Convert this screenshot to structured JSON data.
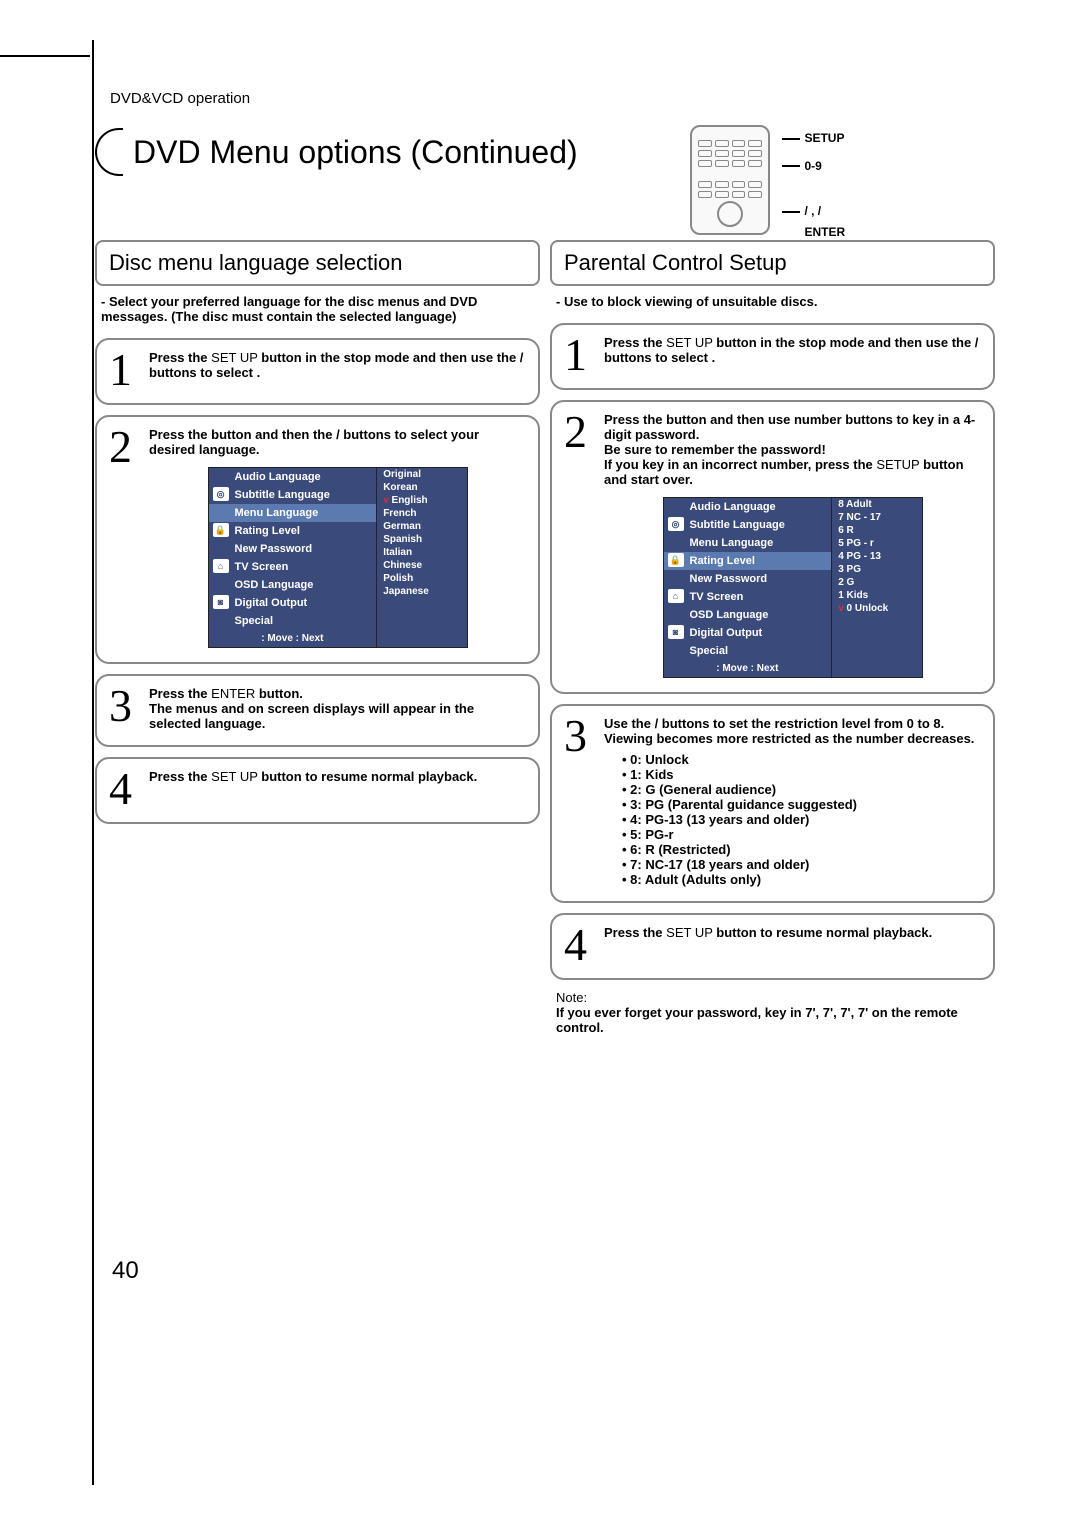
{
  "breadcrumb": "DVD&VCD operation",
  "title": "DVD Menu options (Continued)",
  "remote": {
    "l1": "SETUP",
    "l2": "0-9",
    "l3": "/ ,   /",
    "l4": "ENTER"
  },
  "left": {
    "heading": "Disc menu language selection",
    "intro": "- Select your preferred language for the disc menus and DVD messages. (The disc must contain the selected language)",
    "s1a": "Press the",
    "s1b": " SET UP ",
    "s1c": "button in the stop mode and then use the   /   buttons to select .",
    "s2a": "Press the   button and then the   /   buttons to select your desired language.",
    "s3a": "Press the",
    "s3b": " ENTER ",
    "s3c": "button.",
    "s3d": "The menus and on screen displays will appear in the selected language.",
    "s4a": "Press the",
    "s4b": " SET UP ",
    "s4c": "button to resume normal playback.",
    "osd_left": [
      "Audio Language",
      "Subtitle Language",
      "Menu Language",
      "Rating Level",
      "New Password",
      "TV Screen",
      "OSD Language",
      "Digital Output",
      "Special"
    ],
    "osd_foot": ": Move        : Next",
    "osd_right": [
      "Original",
      "Korean",
      "English",
      "French",
      "German",
      "Spanish",
      "Italian",
      "Chinese",
      "Polish",
      "Japanese"
    ]
  },
  "right": {
    "heading": "Parental Control Setup",
    "intro": "- Use to block viewing of unsuitable discs.",
    "s1a": "Press the",
    "s1b": " SET UP ",
    "s1c": "button in the stop mode and then use the   /   buttons to select .",
    "s2a": "Press the   button and then use number buttons to key in a 4-digit password.",
    "s2b": "Be sure to remember the password!",
    "s2c": "If you key in an incorrect number, press the",
    "s2d": " SETUP ",
    "s2e": "button and start over.",
    "osd_left": [
      "Audio Language",
      "Subtitle Language",
      "Menu Language",
      "Rating Level",
      "New Password",
      "TV Screen",
      "OSD Language",
      "Digital Output",
      "Special"
    ],
    "osd_foot": ": Move        : Next",
    "osd_right": [
      "8  Adult",
      "7  NC - 17",
      "6  R",
      "5  PG - r",
      "4  PG - 13",
      "3  PG",
      "2  G",
      "1  Kids",
      "0  Unlock"
    ],
    "s3a": "Use the   /   buttons to set the restriction level from 0 to 8. Viewing becomes more restricted as the number decreases.",
    "levels": [
      "0: Unlock",
      "1: Kids",
      "2: G (General audience)",
      "3: PG (Parental guidance suggested)",
      "4: PG-13 (13 years and older)",
      "5: PG-r",
      "6: R (Restricted)",
      "7: NC-17 (18 years and older)",
      "8: Adult (Adults only)"
    ],
    "s4a": "Press the",
    "s4b": " SET UP ",
    "s4c": "button to resume normal playback.",
    "note_label": "Note:",
    "note": "If you ever forget your password, key in 7', 7', 7', 7' on the remote control."
  },
  "page_num": "40"
}
